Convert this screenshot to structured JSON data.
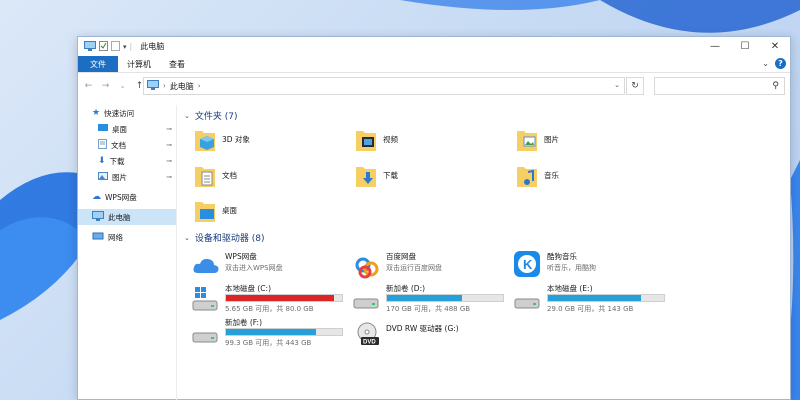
{
  "window": {
    "title": "此电脑",
    "controls": {
      "minimize": "—",
      "maximize": "☐",
      "close": "✕"
    }
  },
  "ribbon": {
    "tabs": [
      {
        "label": "文件",
        "active": true
      },
      {
        "label": "计算机",
        "active": false
      },
      {
        "label": "查看",
        "active": false
      }
    ],
    "help": "?",
    "collapse": "⌄"
  },
  "nav": {
    "back": "←",
    "forward": "→",
    "dropdown": "⌄",
    "up": "↑",
    "address_location": "此电脑",
    "address_sep": "›",
    "address_dropdown": "⌄",
    "refresh": "↻",
    "search_placeholder": ""
  },
  "sidebar": {
    "quick_access": "快速访问",
    "quick_items": [
      {
        "label": "桌面",
        "icon": "desktop-icon"
      },
      {
        "label": "文档",
        "icon": "documents-icon"
      },
      {
        "label": "下载",
        "icon": "downloads-icon"
      },
      {
        "label": "图片",
        "icon": "pictures-icon"
      }
    ],
    "pin_glyph": "📌",
    "wps": "WPS网盘",
    "this_pc": "此电脑",
    "network": "网络"
  },
  "folders": {
    "header": "文件夹 (7)",
    "items": [
      {
        "label": "3D 对象",
        "icon": "3d-objects-folder-icon"
      },
      {
        "label": "视频",
        "icon": "videos-folder-icon"
      },
      {
        "label": "图片",
        "icon": "pictures-folder-icon"
      },
      {
        "label": "文档",
        "icon": "documents-folder-icon"
      },
      {
        "label": "下载",
        "icon": "downloads-folder-icon"
      },
      {
        "label": "音乐",
        "icon": "music-folder-icon"
      },
      {
        "label": "桌面",
        "icon": "desktop-folder-icon"
      }
    ]
  },
  "drives": {
    "header": "设备和驱动器 (8)",
    "items": [
      {
        "name": "WPS网盘",
        "sub": "双击进入WPS网盘",
        "icon": "wps-cloud-icon"
      },
      {
        "name": "百度网盘",
        "sub": "双击运行百度网盘",
        "icon": "baidu-netdisk-icon"
      },
      {
        "name": "酷狗音乐",
        "sub": "听音乐，用酷狗",
        "icon": "kugou-music-icon"
      },
      {
        "name": "本地磁盘 (C:)",
        "size": "5.65 GB 可用，共 80.0 GB",
        "used_fraction": 0.93,
        "warn": true,
        "icon": "windows-drive-icon"
      },
      {
        "name": "新加卷 (D:)",
        "size": "170 GB 可用，共 488 GB",
        "used_fraction": 0.65,
        "icon": "hard-drive-icon"
      },
      {
        "name": "本地磁盘 (E:)",
        "size": "29.0 GB 可用，共 143 GB",
        "used_fraction": 0.8,
        "icon": "hard-drive-icon"
      },
      {
        "name": "新加卷 (F:)",
        "size": "99.3 GB 可用，共 443 GB",
        "used_fraction": 0.78,
        "icon": "hard-drive-icon"
      },
      {
        "name": "DVD RW 驱动器 (G:)",
        "icon": "dvd-drive-icon"
      }
    ]
  }
}
